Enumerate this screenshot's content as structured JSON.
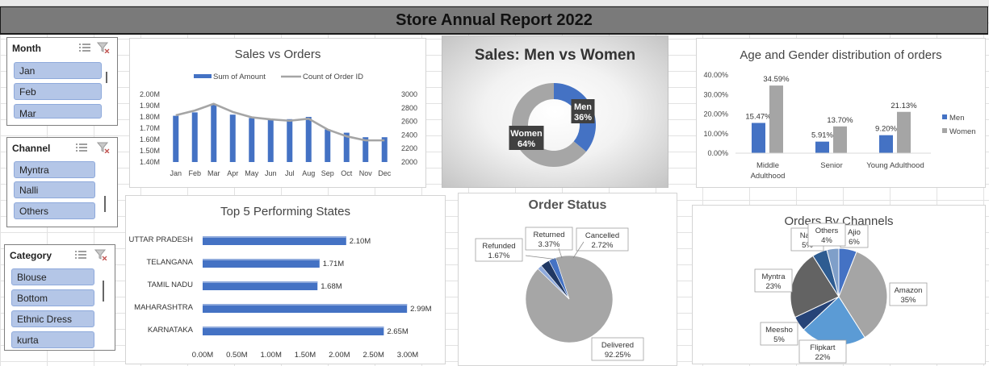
{
  "report_title": "Store Annual Report 2022",
  "slicers": {
    "month": {
      "title": "Month",
      "items": [
        "Jan",
        "Feb",
        "Mar"
      ]
    },
    "channel": {
      "title": "Channel",
      "items": [
        "Myntra",
        "Nalli",
        "Others"
      ]
    },
    "category": {
      "title": "Category",
      "items": [
        "Blouse",
        "Bottom",
        "Ethnic Dress",
        "kurta"
      ]
    }
  },
  "colors": {
    "blue": "#4472c4",
    "gray": "#a5a5a5",
    "dark_gray": "#595959"
  },
  "chart_data": [
    {
      "id": "sales_orders",
      "type": "bar",
      "title": "Sales vs Orders",
      "categories": [
        "Jan",
        "Feb",
        "Mar",
        "Apr",
        "May",
        "Jun",
        "Jul",
        "Aug",
        "Sep",
        "Oct",
        "Nov",
        "Dec"
      ],
      "series": [
        {
          "name": "Sum of Amount",
          "type": "bar",
          "axis": "left",
          "values": [
            1.81,
            1.84,
            1.91,
            1.82,
            1.79,
            1.78,
            1.78,
            1.8,
            1.69,
            1.66,
            1.62,
            1.62
          ]
        },
        {
          "name": "Count of Order ID",
          "type": "line",
          "axis": "right",
          "values": [
            2690,
            2760,
            2860,
            2740,
            2660,
            2630,
            2610,
            2640,
            2480,
            2380,
            2320,
            2320
          ]
        }
      ],
      "ylim": [
        1.4,
        2.0
      ],
      "y_ticks": [
        "2.00M",
        "1.90M",
        "1.80M",
        "1.70M",
        "1.60M",
        "1.50M",
        "1.40M"
      ],
      "y2lim": [
        2000,
        3000
      ],
      "y2_ticks": [
        "3000",
        "2800",
        "2600",
        "2400",
        "2200",
        "2000"
      ],
      "legend": "top"
    },
    {
      "id": "men_women",
      "type": "pie",
      "title": "Sales: Men vs Women",
      "slices": [
        {
          "label": "Men",
          "value": 36,
          "display": "36%"
        },
        {
          "label": "Women",
          "value": 64,
          "display": "64%"
        }
      ]
    },
    {
      "id": "age_gender",
      "type": "bar",
      "title": "Age and Gender distribution of orders",
      "categories": [
        "Middle Adulthood",
        "Senior",
        "Young Adulthood"
      ],
      "series": [
        {
          "name": "Men",
          "values": [
            15.47,
            5.91,
            9.2
          ],
          "labels": [
            "15.47%",
            "5.91%",
            "9.20%"
          ]
        },
        {
          "name": "Women",
          "values": [
            34.59,
            13.7,
            21.13
          ],
          "labels": [
            "34.59%",
            "13.70%",
            "21.13%"
          ]
        }
      ],
      "ylim": [
        0,
        40
      ],
      "y_ticks": [
        "40.00%",
        "30.00%",
        "20.00%",
        "10.00%",
        "0.00%"
      ],
      "legend": "right"
    },
    {
      "id": "top_states",
      "type": "bar",
      "title": "Top 5 Performing States",
      "categories": [
        "UTTAR PRADESH",
        "TELANGANA",
        "TAMIL NADU",
        "MAHARASHTRA",
        "KARNATAKA"
      ],
      "values": [
        2.1,
        1.71,
        1.68,
        2.99,
        2.65
      ],
      "labels": [
        "2.10M",
        "1.71M",
        "1.68M",
        "2.99M",
        "2.65M"
      ],
      "xlim": [
        0,
        3.0
      ],
      "x_ticks": [
        "0.00M",
        "0.50M",
        "1.00M",
        "1.50M",
        "2.00M",
        "2.50M",
        "3.00M"
      ]
    },
    {
      "id": "order_status",
      "type": "pie",
      "title": "Order Status",
      "slices": [
        {
          "label": "Delivered",
          "value": 92.25,
          "display": "92.25%"
        },
        {
          "label": "Refunded",
          "value": 1.67,
          "display": "1.67%"
        },
        {
          "label": "Returned",
          "value": 3.37,
          "display": "3.37%"
        },
        {
          "label": "Cancelled",
          "value": 2.72,
          "display": "2.72%"
        }
      ]
    },
    {
      "id": "channels",
      "type": "pie",
      "title": "Orders By Channels",
      "slices": [
        {
          "label": "Ajio",
          "value": 6,
          "display": "6%"
        },
        {
          "label": "Amazon",
          "value": 35,
          "display": "35%"
        },
        {
          "label": "Flipkart",
          "value": 22,
          "display": "22%"
        },
        {
          "label": "Meesho",
          "value": 5,
          "display": "5%"
        },
        {
          "label": "Myntra",
          "value": 23,
          "display": "23%"
        },
        {
          "label": "Nalli",
          "value": 5,
          "display": "5%"
        },
        {
          "label": "Others",
          "value": 4,
          "display": "4%"
        }
      ]
    }
  ]
}
